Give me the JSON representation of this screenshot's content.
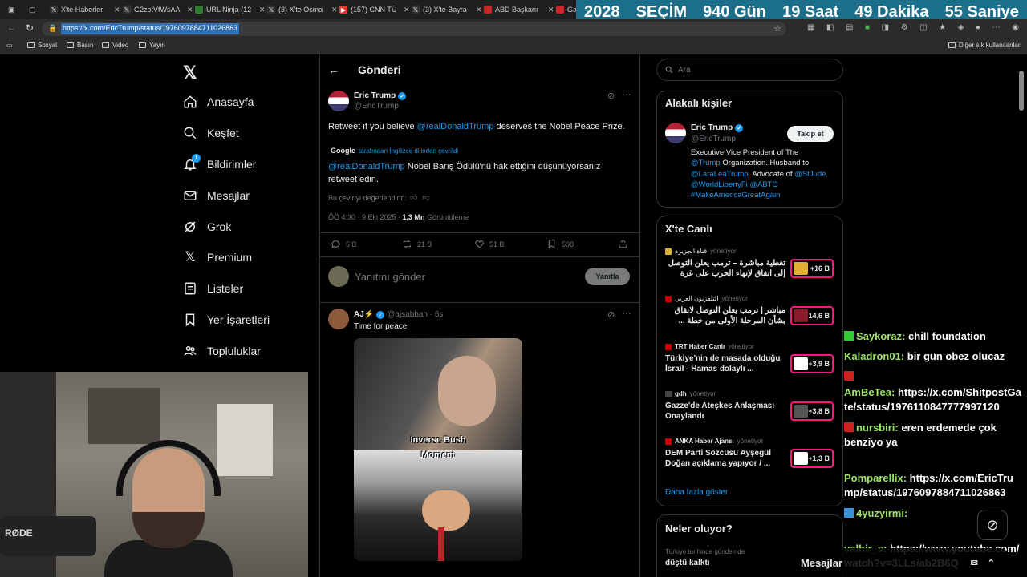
{
  "browser": {
    "tabs": [
      {
        "label": "X'te Haberler",
        "fav_color": "#000"
      },
      {
        "label": "G2zotVfWsAA",
        "fav_color": "#000"
      },
      {
        "label": "URL Ninja (12",
        "fav_color": "#2e7d32"
      },
      {
        "label": "(3) X'te Osma",
        "fav_color": "#000"
      },
      {
        "label": "(157) CNN TÜ",
        "fav_color": "#e53935"
      },
      {
        "label": "(3) X'te Bayra",
        "fav_color": "#000"
      },
      {
        "label": "ABD Başkanı",
        "fav_color": "#c62828"
      },
      {
        "label": "Ga",
        "fav_color": "#c62828"
      }
    ],
    "url": "https://x.com/EricTrump/status/1976097884711026863",
    "bookmarks": [
      "Sosyal",
      "Basın",
      "Video",
      "Yayın"
    ],
    "other_bookmarks": "Diğer sık kullanılanlar"
  },
  "countdown": [
    "2028",
    "SEÇİM",
    "940 Gün",
    "19 Saat",
    "49 Dakika",
    "55 Saniye"
  ],
  "nav": {
    "items": [
      {
        "label": "Anasayfa",
        "icon": "home-icon"
      },
      {
        "label": "Keşfet",
        "icon": "search-icon"
      },
      {
        "label": "Bildirimler",
        "icon": "bell-icon",
        "badge": "1"
      },
      {
        "label": "Mesajlar",
        "icon": "mail-icon"
      },
      {
        "label": "Grok",
        "icon": "grok-icon"
      },
      {
        "label": "Premium",
        "icon": "x-logo-icon"
      },
      {
        "label": "Listeler",
        "icon": "list-icon"
      },
      {
        "label": "Yer İşaretleri",
        "icon": "bookmark-icon"
      },
      {
        "label": "Topluluklar",
        "icon": "people-icon"
      }
    ]
  },
  "post": {
    "header": "Gönderi",
    "author": "Eric Trump",
    "handle": "@EricTrump",
    "text_pre": "Retweet if you believe ",
    "mention": "@realDonaldTrump",
    "text_post": " deserves the Nobel Peace Prize.",
    "translated_by": "Google",
    "translated_note": "tarafından İngilizce dilinden çevrildi",
    "translation_mention": "@realDonaldTrump",
    "translation_rest": " Nobel Barış Ödülü'nü hak ettiğini düşünüyorsanız retweet edin.",
    "rate_translation": "Bu çeviriyi değerlendirin:",
    "time": "ÖÖ 4:30 · 9 Eki 2025 · ",
    "views": "1,3 Mn",
    "views_label": " Görüntüleme",
    "replies": "5 B",
    "retweets": "21 B",
    "likes": "51 B",
    "bookmarks": "508"
  },
  "reply_box": {
    "placeholder": "Yanıtını gönder",
    "button": "Yanıtla"
  },
  "reply": {
    "author": "AJ⚡",
    "handle": "@ajsabbah · 6s",
    "text": "Time for peace",
    "image_caption_1": "Inverse Bush",
    "image_caption_2": "Moment"
  },
  "search": {
    "placeholder": "Ara"
  },
  "related": {
    "title": "Alakalı kişiler",
    "name": "Eric Trump",
    "handle": "@EricTrump",
    "follow": "Takip et",
    "bio_1": "Executive Vice President of The",
    "bio_2_link": "@Trump",
    "bio_2_rest": " Organization. Husband to",
    "bio_3_link": "@LaraLeaTrump",
    "bio_3_rest": ". Advocate of ",
    "bio_3_link2": "@StJude",
    "bio_3_end": ".",
    "bio_4": "@WorldLibertyFi @ABTC",
    "bio_5": "#MakeAmericaGreatAgain"
  },
  "live": {
    "title": "X'te Canlı",
    "items": [
      {
        "source": "قناة الجزيرة",
        "status": "yönetiyor",
        "title": "تغطية مباشرة – ترمب يعلن التوصل إلى اتفاق لإنهاء الحرب على غزة",
        "count": "+16 B"
      },
      {
        "source": "التلفزيون العربي",
        "status": "yönetiyor",
        "title": "مباشر | ترمب يعلن التوصل لاتفاق بشأن المرحلة الأولى من خطة ...",
        "count": "+14,6 B"
      },
      {
        "source": "TRT Haber Canlı",
        "status": "yönetiyor",
        "title": "Türkiye'nin de masada olduğu İsrail - Hamas dolaylı ...",
        "count": "+3,9 B"
      },
      {
        "source": "gdh",
        "status": "yönetiyor",
        "title": "Gazze'de Ateşkes Anlaşması Onaylandı",
        "count": "+3,8 B"
      },
      {
        "source": "ANKA Haber Ajansı",
        "status": "yönetiyor",
        "title": "DEM Parti Sözcüsü Ayşegül Doğan açıklama yapıyor / ...",
        "count": "+1,3 B"
      }
    ],
    "show_more": "Daha fazla göster"
  },
  "happening": {
    "title": "Neler oluyor?",
    "sub": "Türkiye tarihinde gündemde",
    "topic": "düştü kalktı"
  },
  "messages_label": "Mesajlar",
  "chat": [
    {
      "user": "Saykoraz:",
      "msg": " chill foundation"
    },
    {
      "user": "Kaladron01:",
      "msg": " bir gün obez olucaz"
    },
    {
      "user": "AmBeTea:",
      "msg": " https://x.com/ShitpostGate/status/1976110847777997120"
    },
    {
      "user": "nursbiri:",
      "msg": " eren erdemede çok benziyo ya"
    },
    {
      "user": "Pomparellix:",
      "msg": " https://x.com/EricTrump/status/1976097884711026863"
    },
    {
      "user": "4yuzyirmi:",
      "msg": ""
    },
    {
      "user": "valhir_s:",
      "msg": " https://www.youtube.com/watch?v=3LLsiab2B6Q"
    }
  ],
  "colors": {
    "accent": "#1d9bf0",
    "live_border": "#f91880",
    "chat_user": "#9de36a"
  }
}
